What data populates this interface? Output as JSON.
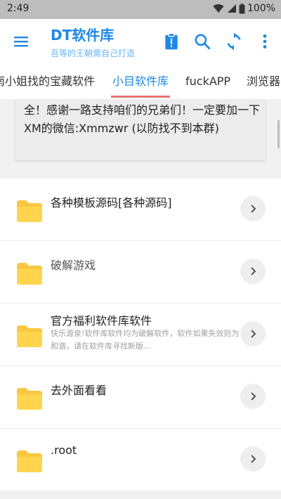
{
  "status_bar": {
    "time": "2:49",
    "battery": "100%"
  },
  "app_bar": {
    "title": "DT软件库",
    "subtitle": "吾等的王朝需自己打造"
  },
  "tabs": [
    {
      "label": "南小姐找的宝藏软件"
    },
    {
      "label": "小目软件库",
      "active": true
    },
    {
      "label": "fuckAPP"
    },
    {
      "label": "浏览器"
    }
  ],
  "notice": {
    "text": "全！感谢一路支持咱们的兄弟们！一定要加一下XM的微信:Xmmzwr (以防找不到本群)"
  },
  "items": [
    {
      "title": "各种模板源码[各种源码]",
      "description": ""
    },
    {
      "title": "破解游戏",
      "description": ""
    },
    {
      "title": "官方福利软件库软件",
      "description": "快乐源泉!软件库软件均为破解软件，软件如果失效则为和谐，请在软件库寻找新版..."
    },
    {
      "title": "去外面看看",
      "description": ""
    },
    {
      "title": ".root",
      "description": ""
    }
  ],
  "colors": {
    "accent": "#1e88e5",
    "tab_indicator": "#e57373",
    "folder": "#ffd54f"
  }
}
